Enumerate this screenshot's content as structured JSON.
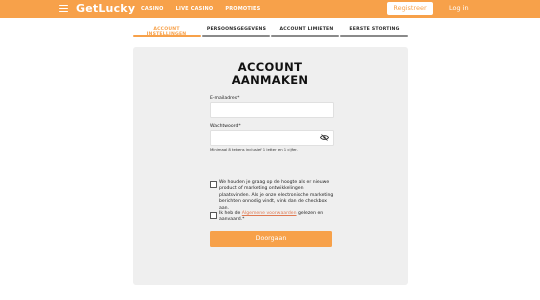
{
  "header": {
    "logo_text": "GetLucky",
    "nav": [
      "CASINO",
      "LIVE CASINO",
      "PROMOTIES"
    ],
    "register_label": "Registreer",
    "login_label": "Log in"
  },
  "steps": [
    {
      "label": "ACCOUNT INSTELLINGEN",
      "active": true
    },
    {
      "label": "PERSOONSGEGEVENS",
      "active": false
    },
    {
      "label": "ACCOUNT LIMIETEN",
      "active": false
    },
    {
      "label": "EERSTE STORTING",
      "active": false
    }
  ],
  "form": {
    "title_line1": "ACCOUNT",
    "title_line2": "AANMAKEN",
    "email_label": "E-mailadres*",
    "email_value": "",
    "password_label": "Wachtwoord*",
    "password_value": "",
    "password_hint": "Minimaal 8 tekens inclusief 1 letter en 1 cijfer.",
    "marketing_text": "We houden je graag op de hoogte als er nieuwe product of marketing ontwikkelingen plaatsvinden. Als je onze electronische marketing berichten onnodig vindt, vink dan de checkbox aan.",
    "terms_prefix": "Ik heb de ",
    "terms_link": "Algemene voorwaarden",
    "terms_suffix": " gelezen en aanvaard.*",
    "submit_label": "Doorgaan"
  },
  "colors": {
    "brand": "#f7a14a",
    "card": "#efefef",
    "link": "#e07a52"
  }
}
